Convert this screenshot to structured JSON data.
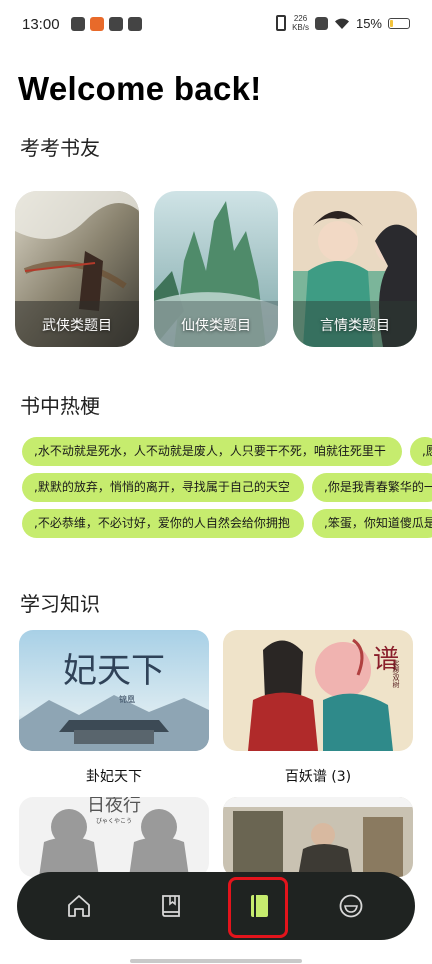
{
  "status_bar": {
    "time": "13:00",
    "net_speed_value": "226",
    "net_speed_unit": "KB/s",
    "battery_text": "15%",
    "battery_level": 0.15,
    "icons": [
      "weibo-icon",
      "taobao-icon",
      "mail-icon",
      "calendar-icon",
      "vibrate-icon",
      "sim-off-icon",
      "wifi-icon",
      "battery-icon"
    ]
  },
  "header": {
    "greeting": "Welcome back!"
  },
  "quiz_section": {
    "title": "考考书友",
    "cards": [
      {
        "label": "武侠类题目"
      },
      {
        "label": "仙侠类题目"
      },
      {
        "label": "言情类题目"
      }
    ]
  },
  "hot_section": {
    "title": "书中热梗",
    "rows": [
      [
        ",水不动就是死水，人不动就是废人，人只要干不死，咱就往死里干",
        ",愿"
      ],
      [
        ",默默的放弃，悄悄的离开，寻找属于自己的天空",
        ",你是我青春繁华的一"
      ],
      [
        ",不必恭维，不必讨好，爱你的人自然会给你拥抱",
        ",笨蛋，你知道傻瓜是"
      ]
    ]
  },
  "study_section": {
    "title": "学习知识",
    "books": [
      {
        "title": "卦妃天下",
        "cover_text": "妃天下",
        "cover_author": "锦凰"
      },
      {
        "title": "百妖谱 (3)",
        "cover_text": "谱",
        "cover_author": "裟椤双树"
      },
      {
        "title": "",
        "cover_text": "日夜行",
        "cover_author": "びゃくやこう"
      },
      {
        "title": "",
        "cover_text": "",
        "cover_author": ""
      }
    ]
  },
  "bottom_nav": {
    "items": [
      "home-icon",
      "bookshelf-icon",
      "book-icon",
      "profile-icon"
    ],
    "active_index": 2,
    "active_color": "#c6ec6e",
    "highlight_color": "#e3141c"
  },
  "colors": {
    "chip_bg": "#c6ec6e",
    "nav_bg": "#1f2321"
  }
}
